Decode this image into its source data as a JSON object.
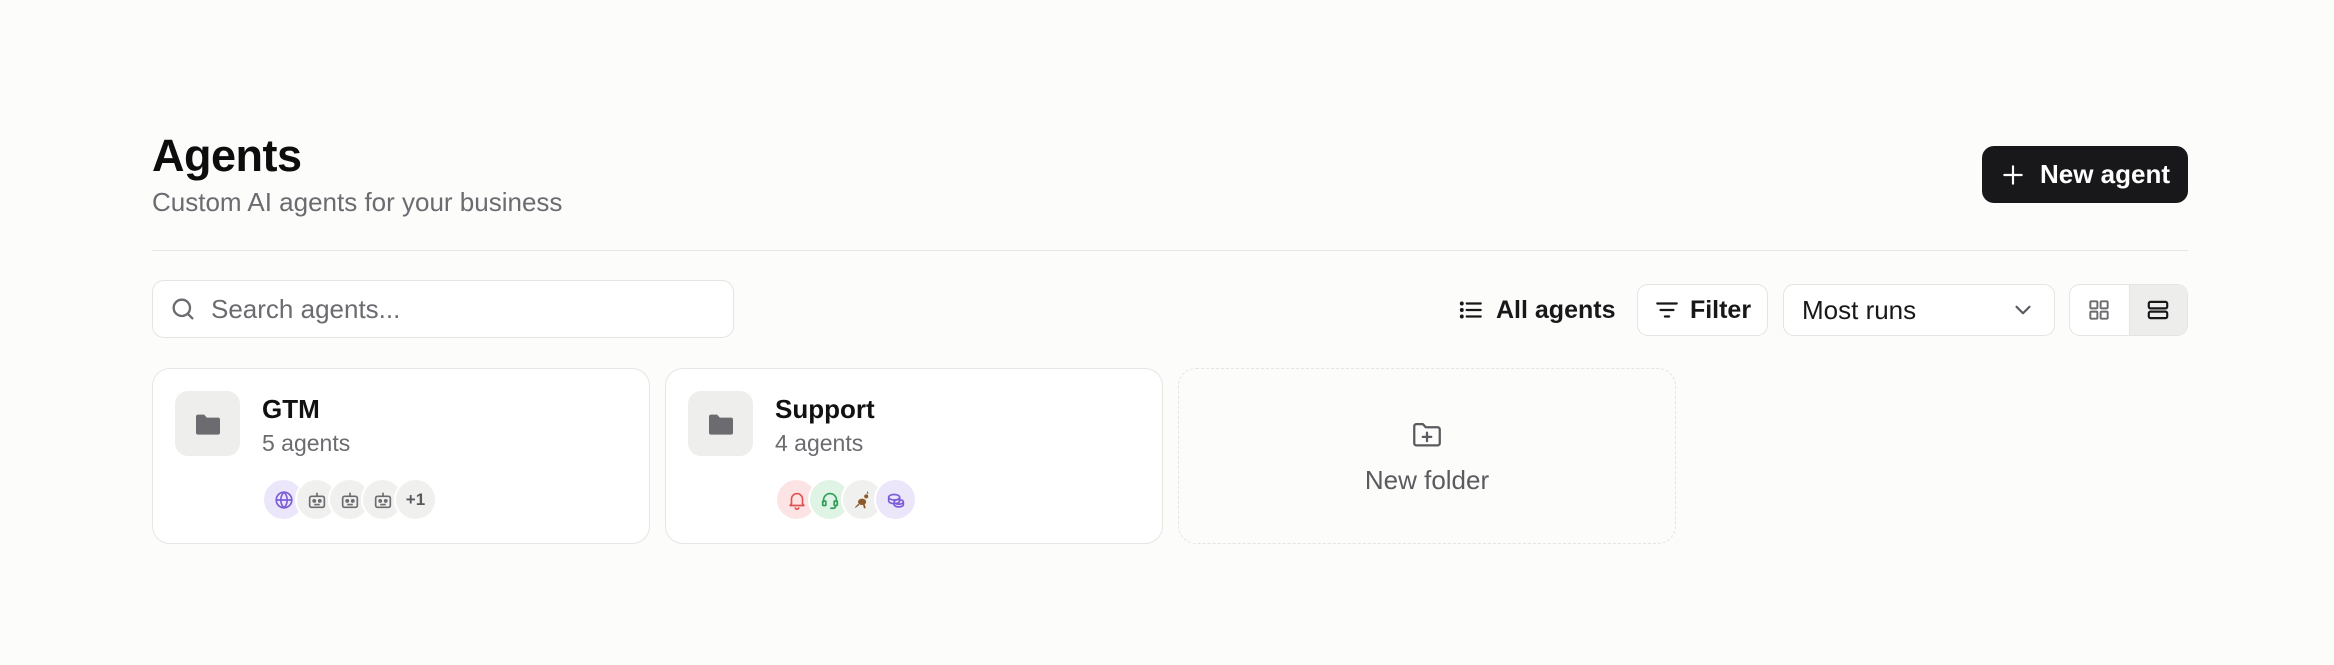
{
  "header": {
    "title": "Agents",
    "subtitle": "Custom AI agents for your business",
    "new_agent_label": "New agent"
  },
  "toolbar": {
    "search_placeholder": "Search agents...",
    "all_agents_label": "All agents",
    "filter_label": "Filter",
    "sort_selected": "Most runs",
    "view_mode": "list"
  },
  "folders": [
    {
      "name": "GTM",
      "count": "5 agents",
      "avatars": [
        {
          "icon": "globe-icon",
          "bg": "#ece6fb",
          "color": "#7c5cd6"
        },
        {
          "icon": "robot-icon",
          "bg": "#f0f0ee",
          "color": "#6b6b70"
        },
        {
          "icon": "robot-icon",
          "bg": "#f0f0ee",
          "color": "#6b6b70"
        },
        {
          "icon": "robot-icon",
          "bg": "#f0f0ee",
          "color": "#6b6b70"
        }
      ],
      "more_label": "+1"
    },
    {
      "name": "Support",
      "count": "4 agents",
      "avatars": [
        {
          "icon": "bell-icon",
          "bg": "#fde4e4",
          "color": "#e05252"
        },
        {
          "icon": "headset-icon",
          "bg": "#dff4e4",
          "color": "#2f9e57"
        },
        {
          "icon": "kangaroo-icon",
          "bg": "#f0f0ee",
          "color": "#8a5a2b"
        },
        {
          "icon": "coins-icon",
          "bg": "#ece6fb",
          "color": "#7c5cd6"
        }
      ]
    }
  ],
  "new_folder_label": "New folder",
  "colors": {
    "background": "#fcfcfb",
    "primary_button": "#18181b",
    "border": "#e4e4e1",
    "muted_text": "#6b6b70"
  }
}
